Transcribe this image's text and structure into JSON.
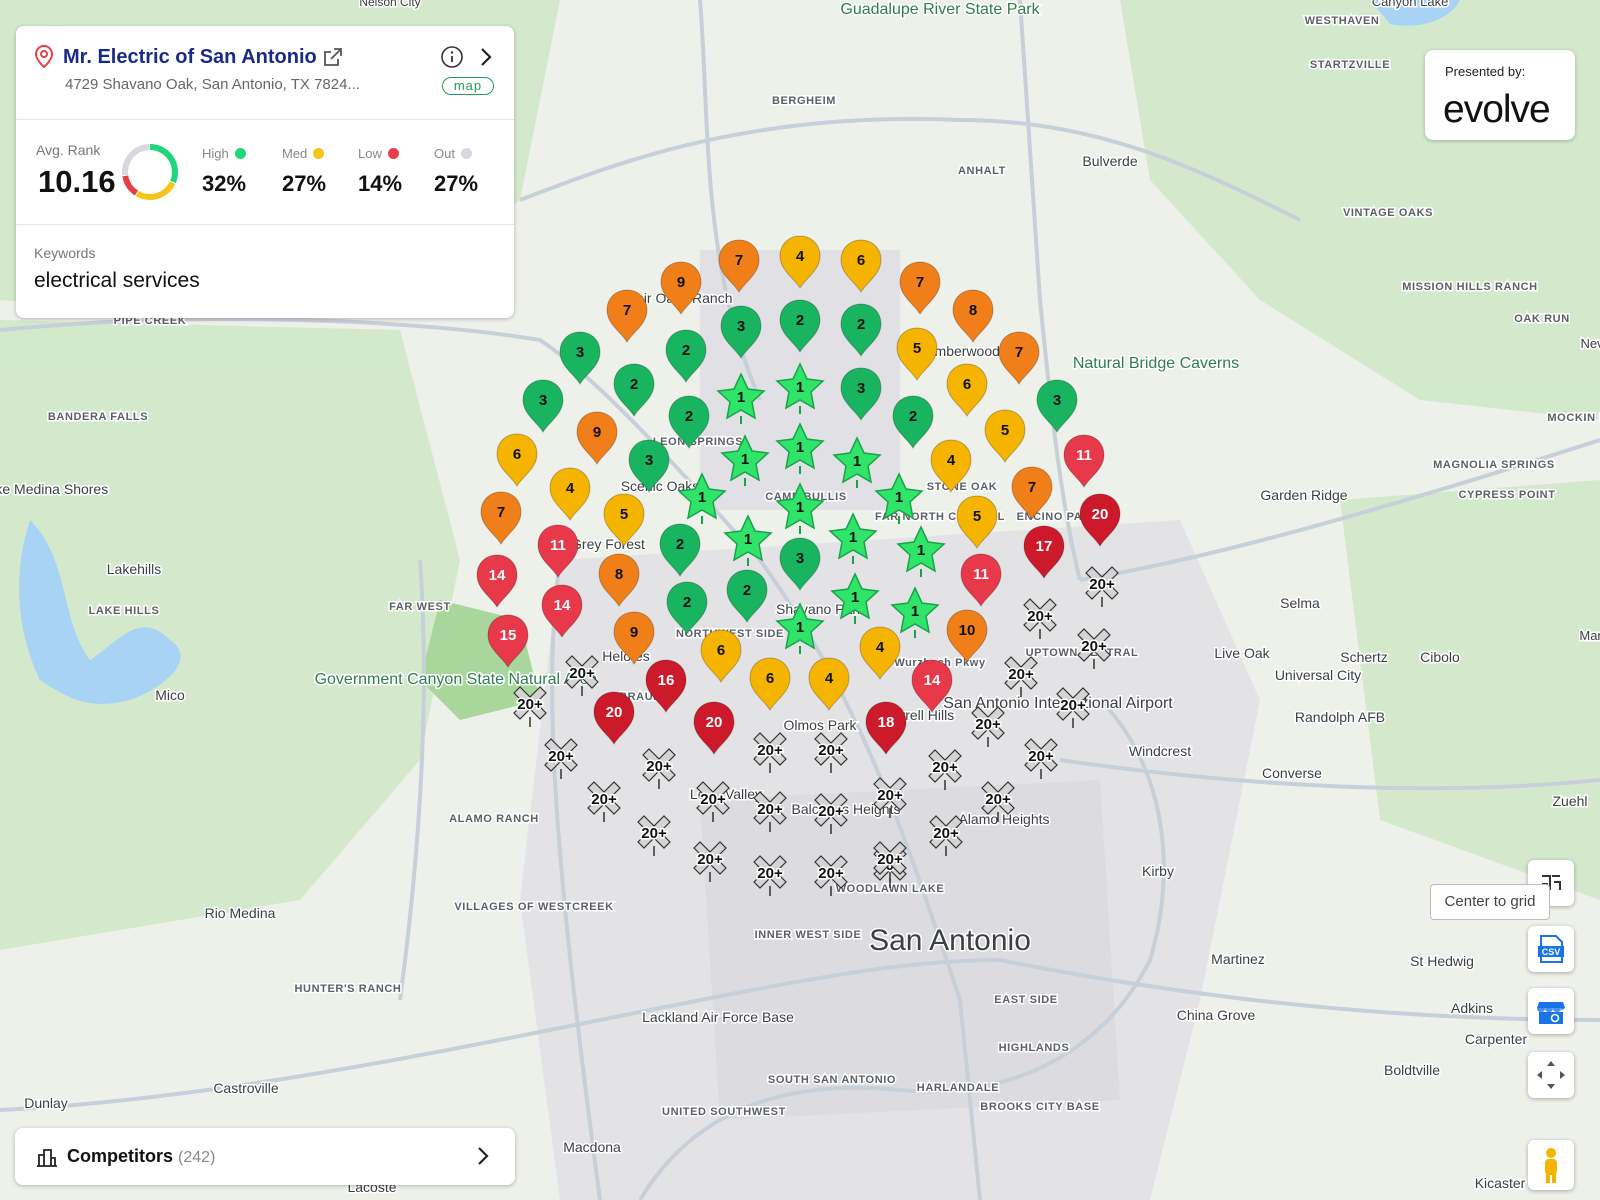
{
  "business": {
    "name": "Mr. Electric of San Antonio",
    "address": "4729 Shavano Oak, San Antonio, TX 7824...",
    "map_badge": "map"
  },
  "stats": {
    "avg_rank_label": "Avg. Rank",
    "avg_rank": "10.16",
    "high": {
      "label": "High",
      "value": "32%",
      "fraction": 0.32,
      "color": "#1fd67a"
    },
    "med": {
      "label": "Med",
      "value": "27%",
      "fraction": 0.27,
      "color": "#f5c518"
    },
    "low": {
      "label": "Low",
      "value": "14%",
      "fraction": 0.14,
      "color": "#e8404a"
    },
    "out": {
      "label": "Out",
      "value": "27%",
      "fraction": 0.27,
      "color": "#d8d8de"
    }
  },
  "keywords": {
    "label": "Keywords",
    "value": "electrical services"
  },
  "sponsor": {
    "label": "Presented by:",
    "logo_text": "evolve"
  },
  "competitors": {
    "label": "Competitors",
    "count": "(242)"
  },
  "controls": {
    "center_tooltip": "Center to grid",
    "csv_label": "CSV"
  },
  "map_labels": [
    "Nelson City",
    "Guadalupe River State Park",
    "Canyon Lake",
    "WESTHAVEN",
    "STARTZVILLE",
    "BERGHEIM",
    "Bulverde",
    "ANHALT",
    "VINTAGE OAKS",
    "MISSION HILLS RANCH",
    "OAK RUN",
    "Natural Bridge Caverns",
    "Timberwood Park",
    "PIPE CREEK",
    "BANDERA FALLS",
    "Lake Medina Shores",
    "Lakehills",
    "LAKE HILLS",
    "Mico",
    "Government Canyon State Natural Area",
    "Rio Medina",
    "HUNTER'S RANCH",
    "VILLAGES OF WESTCREEK",
    "ALAMO RANCH",
    "Castroville",
    "Dunlay",
    "Macdona",
    "Lacoste",
    "Lackland Air Force Base",
    "INNER WEST SIDE",
    "San Antonio",
    "SOUTH SAN ANTONIO",
    "HARLANDALE",
    "UNITED SOUTHWEST",
    "HIGHLANDS",
    "BROOKS CITY BASE",
    "EAST SIDE",
    "Kirby",
    "Windcrest",
    "Converse",
    "Randolph AFB",
    "Live Oak",
    "Universal City",
    "Schertz",
    "Cibolo",
    "Selma",
    "Garden Ridge",
    "MAGNOLIA SPRINGS",
    "CYPRESS POINT",
    "Zuehl",
    "Martinez",
    "St Hedwig",
    "China Grove",
    "Adkins",
    "Carpenter",
    "Boldtville",
    "Kicaster",
    "San Antonio International Airport",
    "Fair Oaks Ranch",
    "LEON SPRINGS",
    "Helotes",
    "Grey Forest",
    "Scenic Oaks",
    "CAMP BULLIS",
    "STONE OAK",
    "FAR NORTH CENTRAL",
    "ENCINO PARK",
    "Shavano Park",
    "NORTHWEST SIDE",
    "BRAUN'S",
    "Leon Valley",
    "Balcones Heights",
    "Alamo Heights",
    "WOODLAWN LAKE",
    "Olmos Park",
    "Terrell Hills",
    "UPTOWN CENTRAL",
    "Wurzbach Pkwy",
    "FAR WEST",
    "Nev",
    "Mari",
    "MOCKIN HEIG"
  ],
  "rank_grid": [
    {
      "rank": "7"
    },
    {
      "rank": "4"
    },
    {
      "rank": "6"
    },
    {
      "rank": "7"
    },
    {
      "rank": "9"
    },
    {
      "rank": "7"
    },
    {
      "rank": "3"
    },
    {
      "rank": "2"
    },
    {
      "rank": "2"
    },
    {
      "rank": "8"
    },
    {
      "rank": "3"
    },
    {
      "rank": "2"
    },
    {
      "rank": "5"
    },
    {
      "rank": "7"
    },
    {
      "rank": "2"
    },
    {
      "rank": "1"
    },
    {
      "rank": "1"
    },
    {
      "rank": "3"
    },
    {
      "rank": "6"
    },
    {
      "rank": "3"
    },
    {
      "rank": "2"
    },
    {
      "rank": "3"
    },
    {
      "rank": "9"
    },
    {
      "rank": "2"
    },
    {
      "rank": "1"
    },
    {
      "rank": "1"
    },
    {
      "rank": "1"
    },
    {
      "rank": "5"
    },
    {
      "rank": "6"
    },
    {
      "rank": "3"
    },
    {
      "rank": "4"
    },
    {
      "rank": "11"
    },
    {
      "rank": "4"
    },
    {
      "rank": "1"
    },
    {
      "rank": "1"
    },
    {
      "rank": "1"
    },
    {
      "rank": "7"
    },
    {
      "rank": "7"
    },
    {
      "rank": "5"
    },
    {
      "rank": "5"
    },
    {
      "rank": "20"
    },
    {
      "rank": "11"
    },
    {
      "rank": "2"
    },
    {
      "rank": "1"
    },
    {
      "rank": "1"
    },
    {
      "rank": "1"
    },
    {
      "rank": "17"
    },
    {
      "rank": "14"
    },
    {
      "rank": "8"
    },
    {
      "rank": "3"
    },
    {
      "rank": "11"
    },
    {
      "rank": "20+"
    },
    {
      "rank": "14"
    },
    {
      "rank": "2"
    },
    {
      "rank": "2"
    },
    {
      "rank": "1"
    },
    {
      "rank": "1"
    },
    {
      "rank": "20+"
    },
    {
      "rank": "15"
    },
    {
      "rank": "9"
    },
    {
      "rank": "1"
    },
    {
      "rank": "10"
    },
    {
      "rank": "20+"
    },
    {
      "rank": "20+"
    },
    {
      "rank": "6"
    },
    {
      "rank": "4"
    },
    {
      "rank": "20+"
    },
    {
      "rank": "20+"
    },
    {
      "rank": "16"
    },
    {
      "rank": "6"
    },
    {
      "rank": "4"
    },
    {
      "rank": "14"
    },
    {
      "rank": "20+"
    },
    {
      "rank": "20"
    },
    {
      "rank": "20"
    },
    {
      "rank": "18"
    },
    {
      "rank": "20+"
    },
    {
      "rank": "20+"
    },
    {
      "rank": "20+"
    },
    {
      "rank": "20+"
    },
    {
      "rank": "20+"
    },
    {
      "rank": "20+"
    },
    {
      "rank": "20+"
    },
    {
      "rank": "20+"
    },
    {
      "rank": "20+"
    },
    {
      "rank": "20+"
    },
    {
      "rank": "20+"
    },
    {
      "rank": "20+"
    },
    {
      "rank": "20+"
    },
    {
      "rank": "20+"
    },
    {
      "rank": "20+"
    },
    {
      "rank": "20+"
    },
    {
      "rank": "20+"
    },
    {
      "rank": "20+"
    },
    {
      "rank": "20+"
    },
    {
      "rank": "20+"
    }
  ]
}
